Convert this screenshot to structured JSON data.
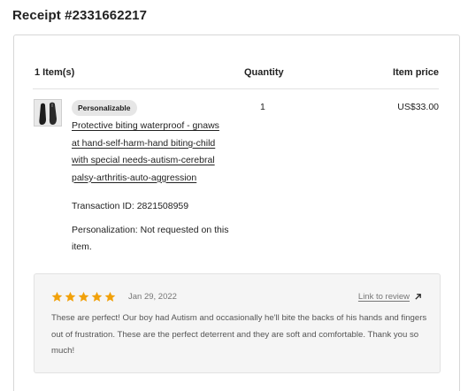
{
  "receipt": {
    "title": "Receipt #2331662217"
  },
  "table": {
    "headers": {
      "items": "1 Item(s)",
      "quantity": "Quantity",
      "price": "Item price"
    }
  },
  "item": {
    "badge": "Personalizable",
    "title": "Protective biting waterproof - gnaws at hand-self-harm-hand biting-child with special needs-autism-cerebral palsy-arthritis-auto-aggression",
    "transaction": "Transaction ID: 2821508959",
    "personalization": "Personalization: Not requested on this item.",
    "quantity": "1",
    "price": "US$33.00",
    "thumbnail_icon": "product-image"
  },
  "review": {
    "rating": 5,
    "rating_max": 5,
    "star_color": "#f1a10a",
    "date": "Jan 29, 2022",
    "link_label": "Link to review",
    "link_icon": "arrow-up-right-icon",
    "text": "These are perfect! Our boy had Autism and occasionally he'll bite the backs of his hands and fingers out of frustration. These are the perfect deterrent and they are soft and comfortable. Thank you so much!"
  }
}
